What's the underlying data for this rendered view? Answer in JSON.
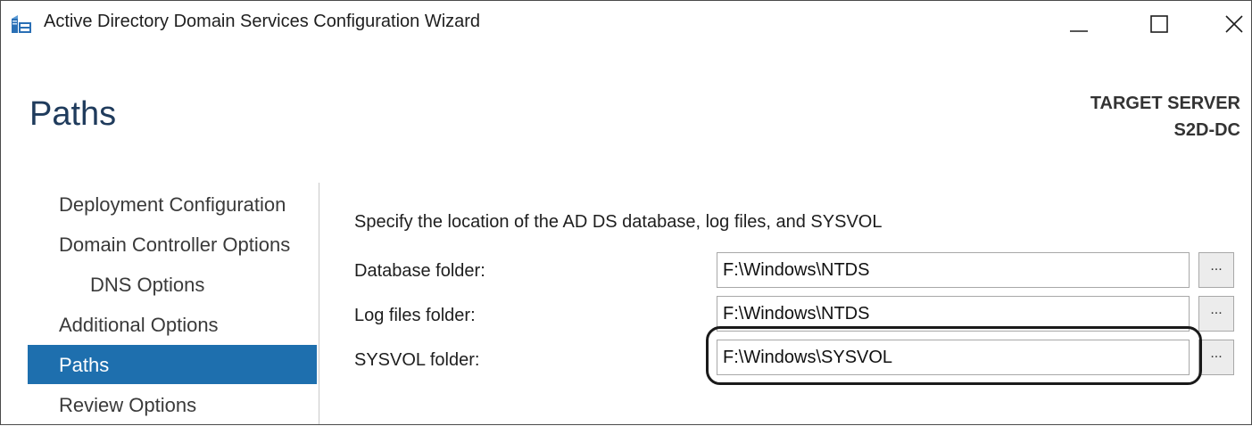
{
  "window": {
    "title": "Active Directory Domain Services Configuration Wizard"
  },
  "page": {
    "title": "Paths"
  },
  "target_server": {
    "label": "TARGET SERVER",
    "name": "S2D-DC"
  },
  "nav": {
    "items": [
      {
        "label": "Deployment Configuration"
      },
      {
        "label": "Domain Controller Options"
      },
      {
        "label": "DNS Options"
      },
      {
        "label": "Additional Options"
      },
      {
        "label": "Paths"
      },
      {
        "label": "Review Options"
      }
    ]
  },
  "main": {
    "description": "Specify the location of the AD DS database, log files, and SYSVOL",
    "database": {
      "label": "Database folder:",
      "value": "F:\\Windows\\NTDS"
    },
    "logs": {
      "label": "Log files folder:",
      "value": "F:\\Windows\\NTDS"
    },
    "sysvol": {
      "label": "SYSVOL folder:",
      "value": "F:\\Windows\\SYSVOL"
    },
    "browse_label": "..."
  },
  "colors": {
    "accent": "#1e6fae",
    "title": "#1f3b5c",
    "highlight": "#1a1a1a"
  }
}
